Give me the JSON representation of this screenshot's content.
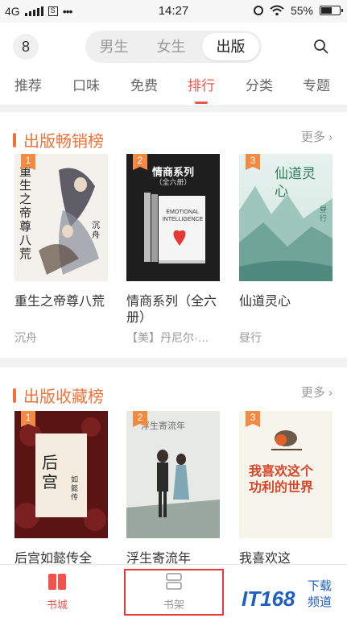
{
  "status_bar": {
    "network": "4G",
    "time": "14:27",
    "battery": "55%",
    "battery_level": 0.55
  },
  "header": {
    "avatar_text": "8",
    "segments": [
      "男生",
      "女生",
      "出版"
    ],
    "active_segment": 2,
    "tabs": [
      "推荐",
      "口味",
      "免费",
      "排行",
      "分类",
      "专题"
    ],
    "active_tab": 3
  },
  "sections": [
    {
      "title": "出版畅销榜",
      "more": "更多",
      "books": [
        {
          "rank": "1",
          "title": "重生之帝尊八荒",
          "author": "沉舟",
          "cover_text": "重生之帝尊八荒",
          "cover_author": "沉舟"
        },
        {
          "rank": "2",
          "title": "情商系列（全六册）",
          "author": "【美】丹尼尔·…",
          "cover_text": "情商系列",
          "cover_sub": "（全六册）",
          "cover_en": "EMOTIONAL INTELLIGENCE"
        },
        {
          "rank": "3",
          "title": "仙道灵心",
          "author": "昼行",
          "cover_text": "仙道灵心",
          "cover_author": "昼行"
        }
      ]
    },
    {
      "title": "出版收藏榜",
      "more": "更多",
      "books": [
        {
          "rank": "1",
          "title": "后宫如懿传全",
          "cover_text": "后宫",
          "cover_sub": "如懿传"
        },
        {
          "rank": "2",
          "title": "浮生寄流年",
          "cover_text": "浮生寄流年"
        },
        {
          "rank": "3",
          "title": "我喜欢这",
          "cover_text": "我喜欢这个功利的世界"
        }
      ]
    }
  ],
  "bottom_nav": [
    {
      "label": "书城",
      "icon": "book-icon"
    },
    {
      "label": "书架",
      "icon": "bookshelf-icon"
    }
  ],
  "watermark": {
    "text": "IT168",
    "sub1": "下载",
    "sub2": "频道"
  },
  "colors": {
    "accent": "#f0544c",
    "section_title": "#f0723a",
    "rank_badge": "#f28a42",
    "highlight_box": "#e53935"
  }
}
